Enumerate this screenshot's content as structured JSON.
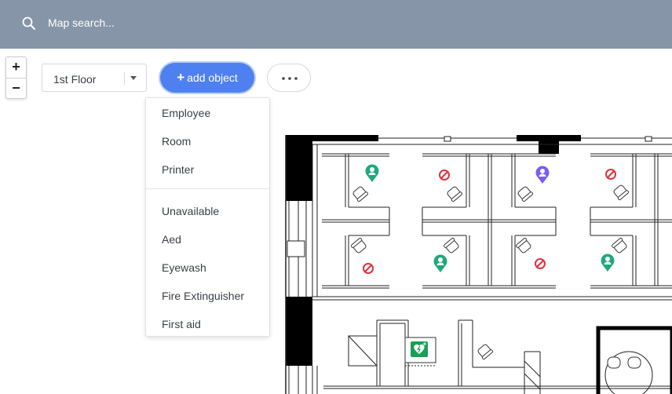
{
  "search": {
    "placeholder": "Map search..."
  },
  "zoom": {
    "in_label": "+",
    "out_label": "−"
  },
  "floor_select": {
    "value": "1st Floor"
  },
  "toolbar": {
    "add_label": "add object",
    "add_plus": "+"
  },
  "menu": {
    "group1": [
      "Employee",
      "Room",
      "Printer"
    ],
    "group2": [
      "Unavailable",
      "Aed",
      "Eyewash",
      "Fire Extinguisher",
      "First aid"
    ]
  },
  "colors": {
    "topbar": "#8795a9",
    "accent": "#4f80f0",
    "employee_pin": "#1fa97a",
    "selected_pin": "#7b5cf0",
    "unavailable": "#e0313d"
  },
  "map_icons": [
    "employee-pin-icon",
    "unavailable-icon",
    "selected-employee-pin-icon",
    "aed-icon",
    "chair-icon"
  ]
}
